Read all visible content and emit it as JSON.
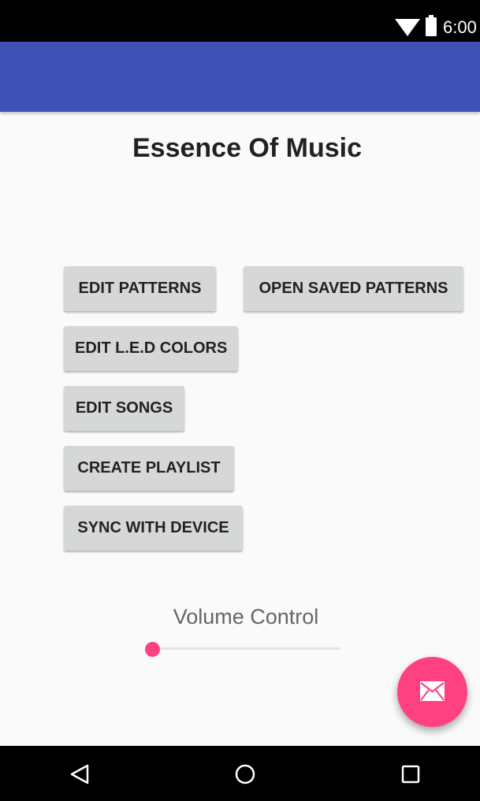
{
  "status_bar": {
    "time": "6:00",
    "icons": [
      "wifi-icon",
      "battery-icon"
    ]
  },
  "app_bar": {
    "color": "#3f51b5"
  },
  "main": {
    "title": "Essence Of Music",
    "buttons": {
      "edit_patterns": "EDIT PATTERNS",
      "open_saved_patterns": "OPEN SAVED PATTERNS",
      "edit_led_colors": "EDIT L.E.D COLORS",
      "edit_songs": "EDIT SONGS",
      "create_playlist": "CREATE PLAYLIST",
      "sync_with_device": "SYNC WITH DEVICE"
    },
    "volume": {
      "label": "Volume Control",
      "value_percent": 0
    }
  },
  "fab": {
    "icon": "mail-icon",
    "color": "#ff4081"
  },
  "nav_bar": {
    "icons": [
      "back-icon",
      "home-icon",
      "recents-icon"
    ]
  },
  "colors": {
    "primary": "#3f51b5",
    "accent": "#ff4081",
    "button_bg": "#d6d7d7"
  }
}
